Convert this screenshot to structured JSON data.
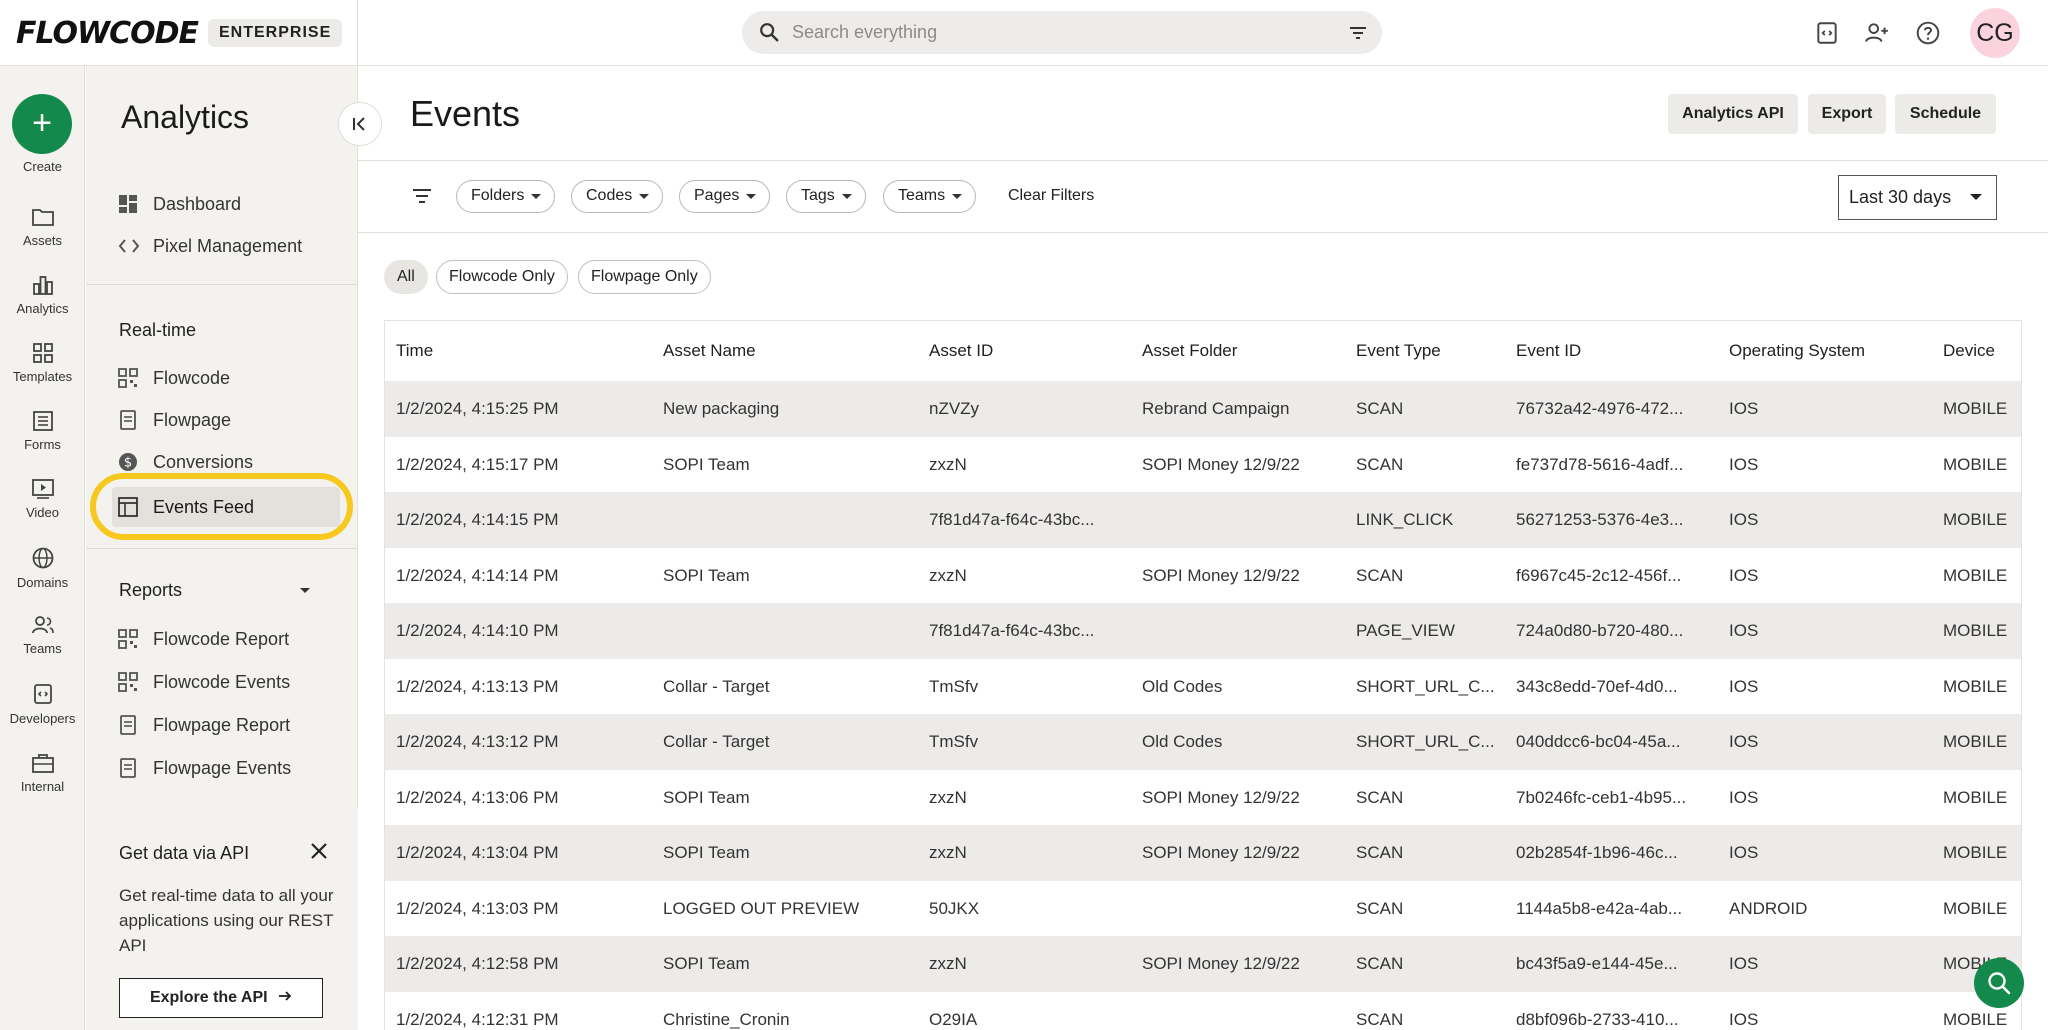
{
  "topbar": {
    "logo": "FLOWCODE",
    "badge": "ENTERPRISE",
    "search_placeholder": "Search everything",
    "avatar_initials": "CG"
  },
  "rail": [
    {
      "label": "Create"
    },
    {
      "label": "Assets"
    },
    {
      "label": "Analytics"
    },
    {
      "label": "Templates"
    },
    {
      "label": "Forms"
    },
    {
      "label": "Video"
    },
    {
      "label": "Domains"
    },
    {
      "label": "Teams"
    },
    {
      "label": "Developers"
    },
    {
      "label": "Internal"
    }
  ],
  "sidebar": {
    "title": "Analytics",
    "top_items": [
      "Dashboard",
      "Pixel Management"
    ],
    "realtime_heading": "Real-time",
    "realtime_items": [
      "Flowcode",
      "Flowpage",
      "Conversions",
      "Events Feed"
    ],
    "reports_heading": "Reports",
    "report_items": [
      "Flowcode Report",
      "Flowcode Events",
      "Flowpage Report",
      "Flowpage Events"
    ],
    "api": {
      "title": "Get data via API",
      "text": "Get real-time data to all your applications using our REST API",
      "button": "Explore the API"
    }
  },
  "main": {
    "title": "Events",
    "actions": [
      "Analytics API",
      "Export",
      "Schedule"
    ],
    "filters": [
      "Folders",
      "Codes",
      "Pages",
      "Tags",
      "Teams"
    ],
    "clear_filters": "Clear Filters",
    "date_range": "Last 30 days",
    "segments": [
      "All",
      "Flowcode Only",
      "Flowpage Only"
    ],
    "active_segment": "All"
  },
  "table": {
    "columns": [
      "Time",
      "Asset Name",
      "Asset ID",
      "Asset Folder",
      "Event Type",
      "Event ID",
      "Operating System",
      "Device"
    ],
    "rows": [
      [
        "1/2/2024, 4:15:25 PM",
        "New packaging",
        "nZVZy",
        "Rebrand Campaign",
        "SCAN",
        "76732a42-4976-472...",
        "IOS",
        "MOBILE"
      ],
      [
        "1/2/2024, 4:15:17 PM",
        "SOPI Team",
        "zxzN",
        "SOPI Money 12/9/22",
        "SCAN",
        "fe737d78-5616-4adf...",
        "IOS",
        "MOBILE"
      ],
      [
        "1/2/2024, 4:14:15 PM",
        "",
        "7f81d47a-f64c-43bc...",
        "",
        "LINK_CLICK",
        "56271253-5376-4e3...",
        "IOS",
        "MOBILE"
      ],
      [
        "1/2/2024, 4:14:14 PM",
        "SOPI Team",
        "zxzN",
        "SOPI Money 12/9/22",
        "SCAN",
        "f6967c45-2c12-456f...",
        "IOS",
        "MOBILE"
      ],
      [
        "1/2/2024, 4:14:10 PM",
        "",
        "7f81d47a-f64c-43bc...",
        "",
        "PAGE_VIEW",
        "724a0d80-b720-480...",
        "IOS",
        "MOBILE"
      ],
      [
        "1/2/2024, 4:13:13 PM",
        "Collar - Target",
        "TmSfv",
        "Old Codes",
        "SHORT_URL_C...",
        "343c8edd-70ef-4d0...",
        "IOS",
        "MOBILE"
      ],
      [
        "1/2/2024, 4:13:12 PM",
        "Collar - Target",
        "TmSfv",
        "Old Codes",
        "SHORT_URL_C...",
        "040ddcc6-bc04-45a...",
        "IOS",
        "MOBILE"
      ],
      [
        "1/2/2024, 4:13:06 PM",
        "SOPI Team",
        "zxzN",
        "SOPI Money 12/9/22",
        "SCAN",
        "7b0246fc-ceb1-4b95...",
        "IOS",
        "MOBILE"
      ],
      [
        "1/2/2024, 4:13:04 PM",
        "SOPI Team",
        "zxzN",
        "SOPI Money 12/9/22",
        "SCAN",
        "02b2854f-1b96-46c...",
        "IOS",
        "MOBILE"
      ],
      [
        "1/2/2024, 4:13:03 PM",
        "LOGGED OUT PREVIEW",
        "50JKX",
        "",
        "SCAN",
        "1144a5b8-e42a-4ab...",
        "ANDROID",
        "MOBILE"
      ],
      [
        "1/2/2024, 4:12:58 PM",
        "SOPI Team",
        "zxzN",
        "SOPI Money 12/9/22",
        "SCAN",
        "bc43f5a9-e144-45e...",
        "IOS",
        "MOBILE"
      ],
      [
        "1/2/2024, 4:12:31 PM",
        "Christine_Cronin",
        "O29IA",
        "",
        "SCAN",
        "d8bf096b-2733-410...",
        "IOS",
        "MOBILE"
      ]
    ]
  },
  "colors": {
    "brand_green": "#138a4c",
    "highlight_yellow": "#f7c81e",
    "avatar_pink": "#fbd3de"
  },
  "icons": [
    "search-icon",
    "filter-icon",
    "developer-icon",
    "add-user-icon",
    "help-icon",
    "chevron-left-icon",
    "close-icon",
    "arrow-right-icon",
    "chat-search-icon"
  ]
}
